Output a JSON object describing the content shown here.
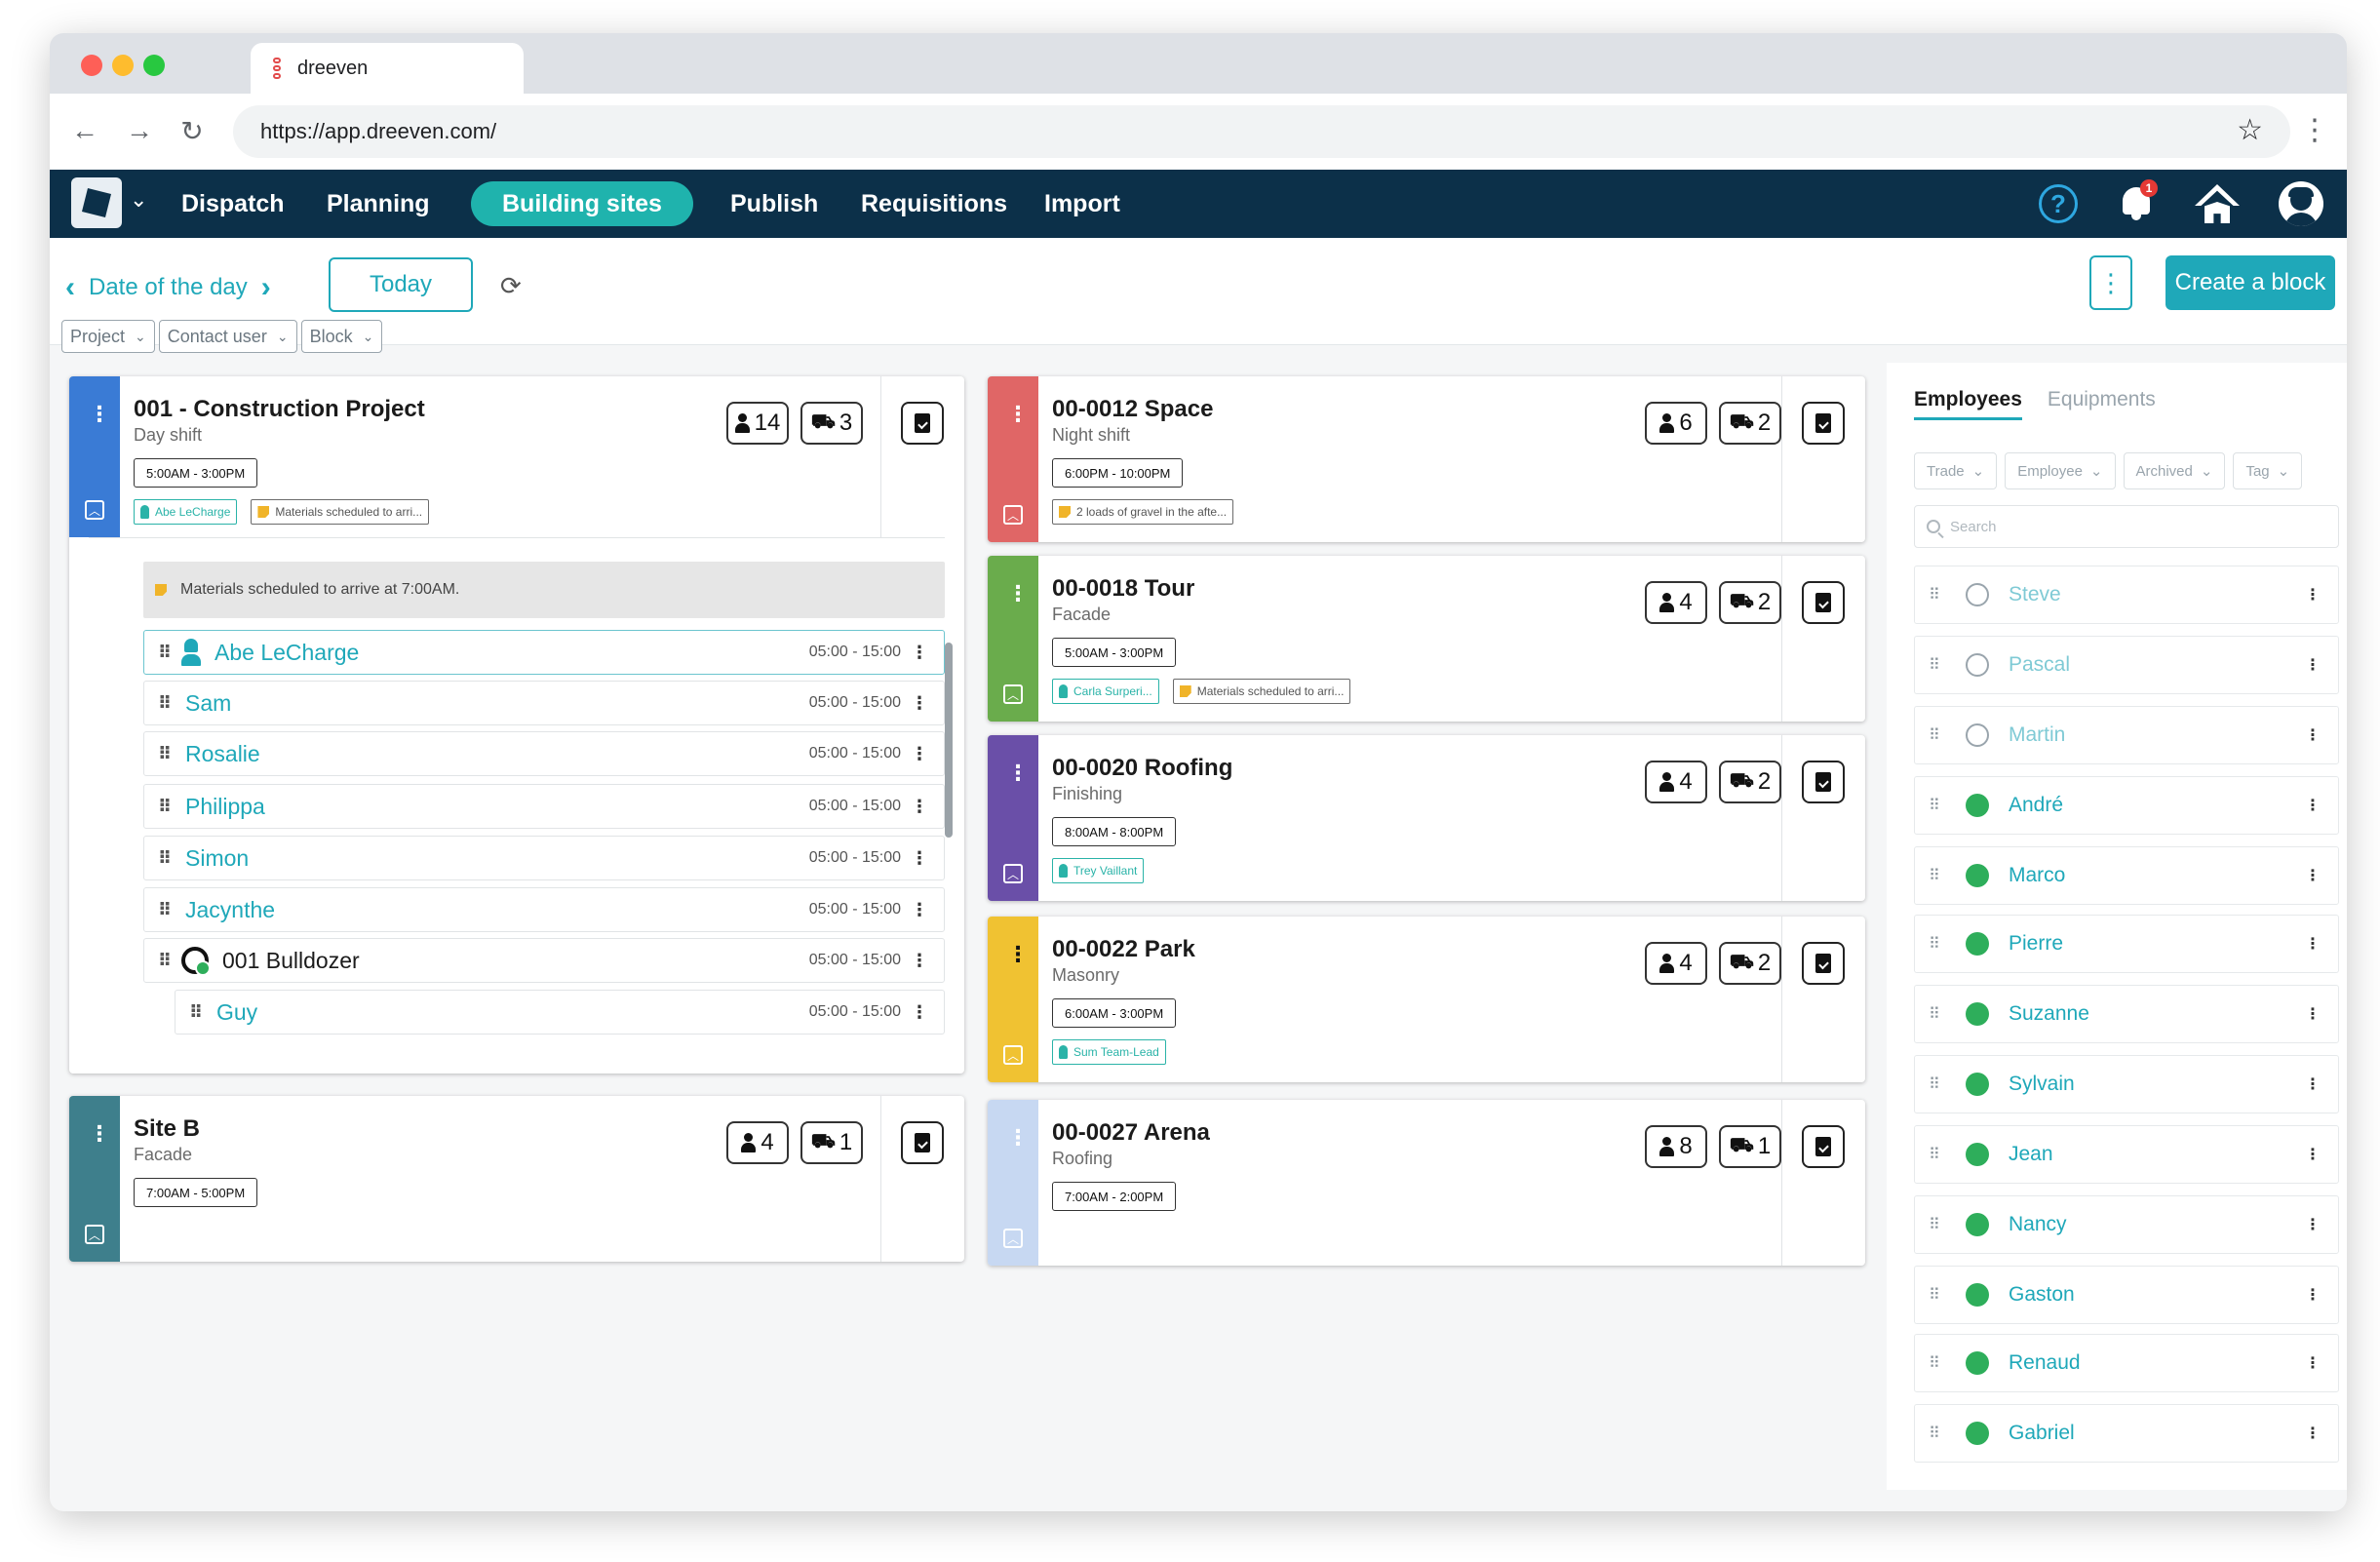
{
  "browser": {
    "tab_title": "dreeven",
    "url": "https://app.dreeven.com/"
  },
  "nav": {
    "items": [
      "Dispatch",
      "Planning",
      "Building sites",
      "Publish",
      "Requisitions",
      "Import"
    ],
    "active": "Building sites",
    "help_label": "?",
    "notification_count": "1"
  },
  "toolbar": {
    "date_label": "Date of the day",
    "today_label": "Today",
    "create_label": "Create a block",
    "filters": [
      "Project",
      "Contact user",
      "Block"
    ]
  },
  "sites": [
    {
      "title": "001 - Construction Project",
      "subtitle": "Day shift",
      "time": "5:00AM - 3:00PM",
      "employees": "14",
      "equipment": "3",
      "color": "#3a7bd5",
      "tags": [
        {
          "type": "person",
          "text": "Abe LeCharge"
        },
        {
          "type": "note",
          "text": "Materials scheduled to arri..."
        }
      ]
    },
    {
      "title": "Site B",
      "subtitle": "Facade",
      "time": "7:00AM - 5:00PM",
      "employees": "4",
      "equipment": "1",
      "color": "#3e7f8c",
      "tags": []
    },
    {
      "title": "00-0012 Space",
      "subtitle": "Night shift",
      "time": "6:00PM - 10:00PM",
      "employees": "6",
      "equipment": "2",
      "color": "#e06666",
      "tags": [
        {
          "type": "note",
          "text": "2 loads of gravel in the afte..."
        }
      ]
    },
    {
      "title": "00-0018 Tour",
      "subtitle": "Facade",
      "time": "5:00AM - 3:00PM",
      "employees": "4",
      "equipment": "2",
      "color": "#6aac4c",
      "tags": [
        {
          "type": "person",
          "text": "Carla Surperi..."
        },
        {
          "type": "note",
          "text": "Materials scheduled to arri..."
        }
      ]
    },
    {
      "title": "00-0020 Roofing",
      "subtitle": "Finishing",
      "time": "8:00AM - 8:00PM",
      "employees": "4",
      "equipment": "2",
      "color": "#6a4fa8",
      "tags": [
        {
          "type": "person",
          "text": "Trey Vaillant"
        }
      ]
    },
    {
      "title": "00-0022 Park",
      "subtitle": "Masonry",
      "time": "6:00AM - 3:00PM",
      "employees": "4",
      "equipment": "2",
      "color": "#f0c232",
      "tags": [
        {
          "type": "person",
          "text": "Sum Team-Lead"
        }
      ]
    },
    {
      "title": "00-0027 Arena",
      "subtitle": "Roofing",
      "time": "7:00AM - 2:00PM",
      "employees": "8",
      "equipment": "1",
      "color": "#c7d8f2",
      "tags": []
    }
  ],
  "roster": {
    "note": "Materials scheduled to arrive at 7:00AM.",
    "rows": [
      {
        "name": "Abe LeCharge",
        "time": "05:00 - 15:00",
        "kind": "lead"
      },
      {
        "name": "Sam",
        "time": "05:00 - 15:00",
        "kind": "employee"
      },
      {
        "name": "Rosalie",
        "time": "05:00 - 15:00",
        "kind": "employee"
      },
      {
        "name": "Philippa",
        "time": "05:00 - 15:00",
        "kind": "employee"
      },
      {
        "name": "Simon",
        "time": "05:00 - 15:00",
        "kind": "employee"
      },
      {
        "name": "Jacynthe",
        "time": "05:00 - 15:00",
        "kind": "employee"
      },
      {
        "name": "001 Bulldozer",
        "time": "05:00 - 15:00",
        "kind": "equipment"
      },
      {
        "name": "Guy",
        "time": "05:00 - 15:00",
        "kind": "operator"
      }
    ]
  },
  "panel": {
    "tabs": [
      "Employees",
      "Equipments"
    ],
    "active_tab": "Employees",
    "filters": [
      "Trade",
      "Employee",
      "Archived",
      "Tag"
    ],
    "search_placeholder": "Search",
    "employees": [
      {
        "name": "Steve",
        "available": false
      },
      {
        "name": "Pascal",
        "available": false
      },
      {
        "name": "Martin",
        "available": false
      },
      {
        "name": "André",
        "available": true
      },
      {
        "name": "Marco",
        "available": true
      },
      {
        "name": "Pierre",
        "available": true
      },
      {
        "name": "Suzanne",
        "available": true
      },
      {
        "name": "Sylvain",
        "available": true
      },
      {
        "name": "Jean",
        "available": true
      },
      {
        "name": "Nancy",
        "available": true
      },
      {
        "name": "Gaston",
        "available": true
      },
      {
        "name": "Renaud",
        "available": true
      },
      {
        "name": "Gabriel",
        "available": true
      }
    ]
  },
  "colors": {
    "nav_bg": "#0c3049",
    "accent": "#1fa8b9",
    "available": "#2eae5b"
  }
}
